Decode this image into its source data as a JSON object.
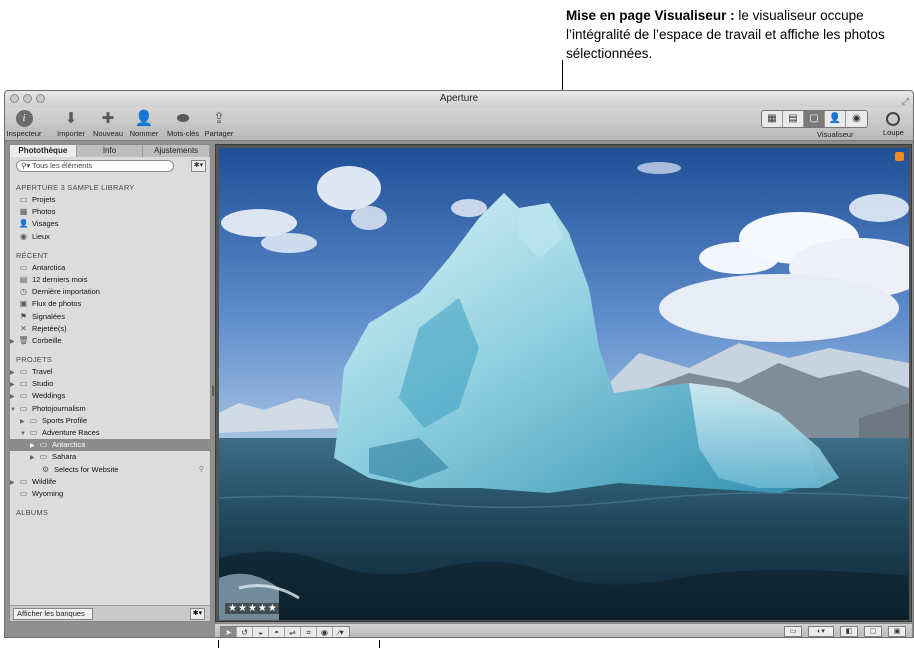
{
  "callout": {
    "title": "Mise en page Visualiseur :",
    "text": " le visualiseur occupe l’intégralité de l’espace de travail et affiche les photos sélectionnées."
  },
  "window": {
    "title": "Aperture"
  },
  "toolbar": {
    "items": [
      {
        "label": "Inspecteur",
        "icon": "inspector-icon"
      },
      {
        "label": "Importer",
        "icon": "import-arrow-icon"
      },
      {
        "label": "Nouveau",
        "icon": "plus-icon"
      },
      {
        "label": "Nommer",
        "icon": "person-icon"
      },
      {
        "label": "Mots-clés",
        "icon": "tag-icon"
      },
      {
        "label": "Partager",
        "icon": "share-icon"
      }
    ],
    "viewer_label": "Visualiseur",
    "loupe_label": "Loupe"
  },
  "sidebar": {
    "tabs": [
      "Photothèque",
      "Info",
      "Ajustements"
    ],
    "search_placeholder": "Tous les éléments",
    "library_header": "APERTURE 3 SAMPLE LIBRARY",
    "library_items": [
      "Projets",
      "Photos",
      "Visages",
      "Lieux"
    ],
    "recent_header": "RÉCENT",
    "recent_items": [
      "Antarctica",
      "12 derniers mois",
      "Dernière importation",
      "Flux de photos",
      "Signalées",
      "Rejetée(s)",
      "Corbeille"
    ],
    "projects_header": "PROJETS",
    "project_items": [
      "Travel",
      "Studio",
      "Weddings",
      "Photojournalism",
      "Sports Profile",
      "Adventure Races",
      "Antarctica",
      "Sahara",
      "Selects for Website",
      "Wildlife",
      "Wyoming"
    ],
    "albums_header": "ALBUMS",
    "footer_button": "Afficher les banques"
  },
  "viewer": {
    "rating": "★★★★★"
  },
  "colors": {
    "accent_badge": "#ee8a1c",
    "selection": "#8c8c8c"
  }
}
